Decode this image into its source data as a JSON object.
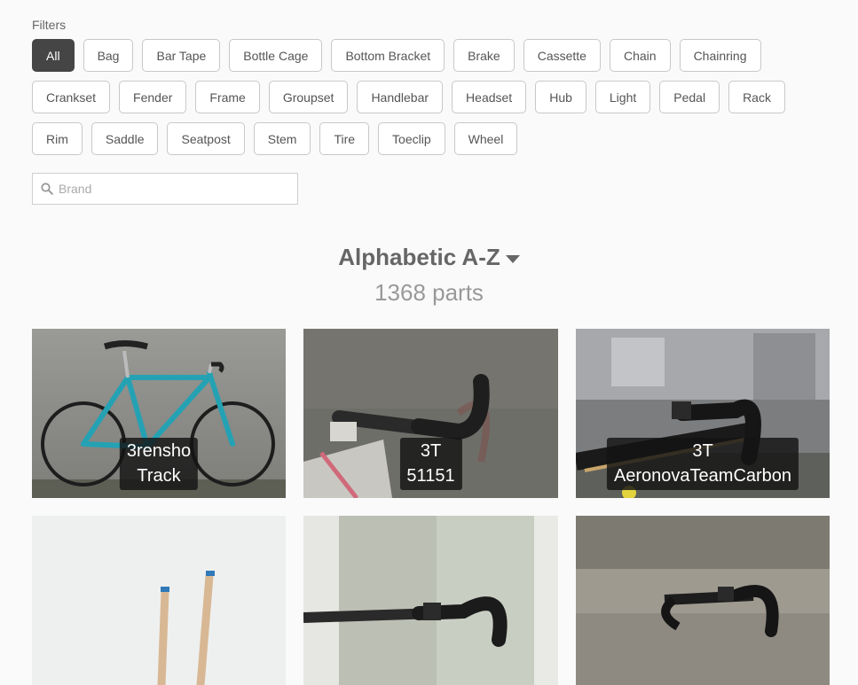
{
  "filters": {
    "label": "Filters",
    "items": [
      "All",
      "Bag",
      "Bar Tape",
      "Bottle Cage",
      "Bottom Bracket",
      "Brake",
      "Cassette",
      "Chain",
      "Chainring",
      "Crankset",
      "Fender",
      "Frame",
      "Groupset",
      "Handlebar",
      "Headset",
      "Hub",
      "Light",
      "Pedal",
      "Rack",
      "Rim",
      "Saddle",
      "Seatpost",
      "Stem",
      "Tire",
      "Toeclip",
      "Wheel"
    ],
    "active": "All"
  },
  "search": {
    "placeholder": "Brand",
    "value": ""
  },
  "sort": {
    "label": "Alphabetic A-Z",
    "icon": "caret-down-icon"
  },
  "count_text": "1368 parts",
  "cards": [
    {
      "brand": "3rensho",
      "model": "Track",
      "bg": "#8a8a86"
    },
    {
      "brand": "3T",
      "model": "51151",
      "bg": "#6d6e69"
    },
    {
      "brand": "3T",
      "model": "AeronovaTeamCarbon",
      "bg": "#7b7c7d"
    },
    {
      "brand": "",
      "model": "",
      "bg": "#f1f1f1"
    },
    {
      "brand": "",
      "model": "",
      "bg": "#b9bcaf"
    },
    {
      "brand": "",
      "model": "",
      "bg": "#8d8a82"
    }
  ]
}
